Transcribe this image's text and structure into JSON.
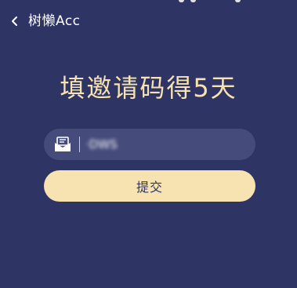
{
  "nav": {
    "back_icon": "chevron-left-icon",
    "title": "树懒Acc"
  },
  "headline": "填邀请码得5天",
  "code_field": {
    "icon": "envelope-icon",
    "value": "·DWS"
  },
  "submit_label": "提交",
  "colors": {
    "background": "#2e3564",
    "field_background": "#454b7a",
    "accent": "#f7e2b2",
    "nav_text": "#ffffff"
  }
}
